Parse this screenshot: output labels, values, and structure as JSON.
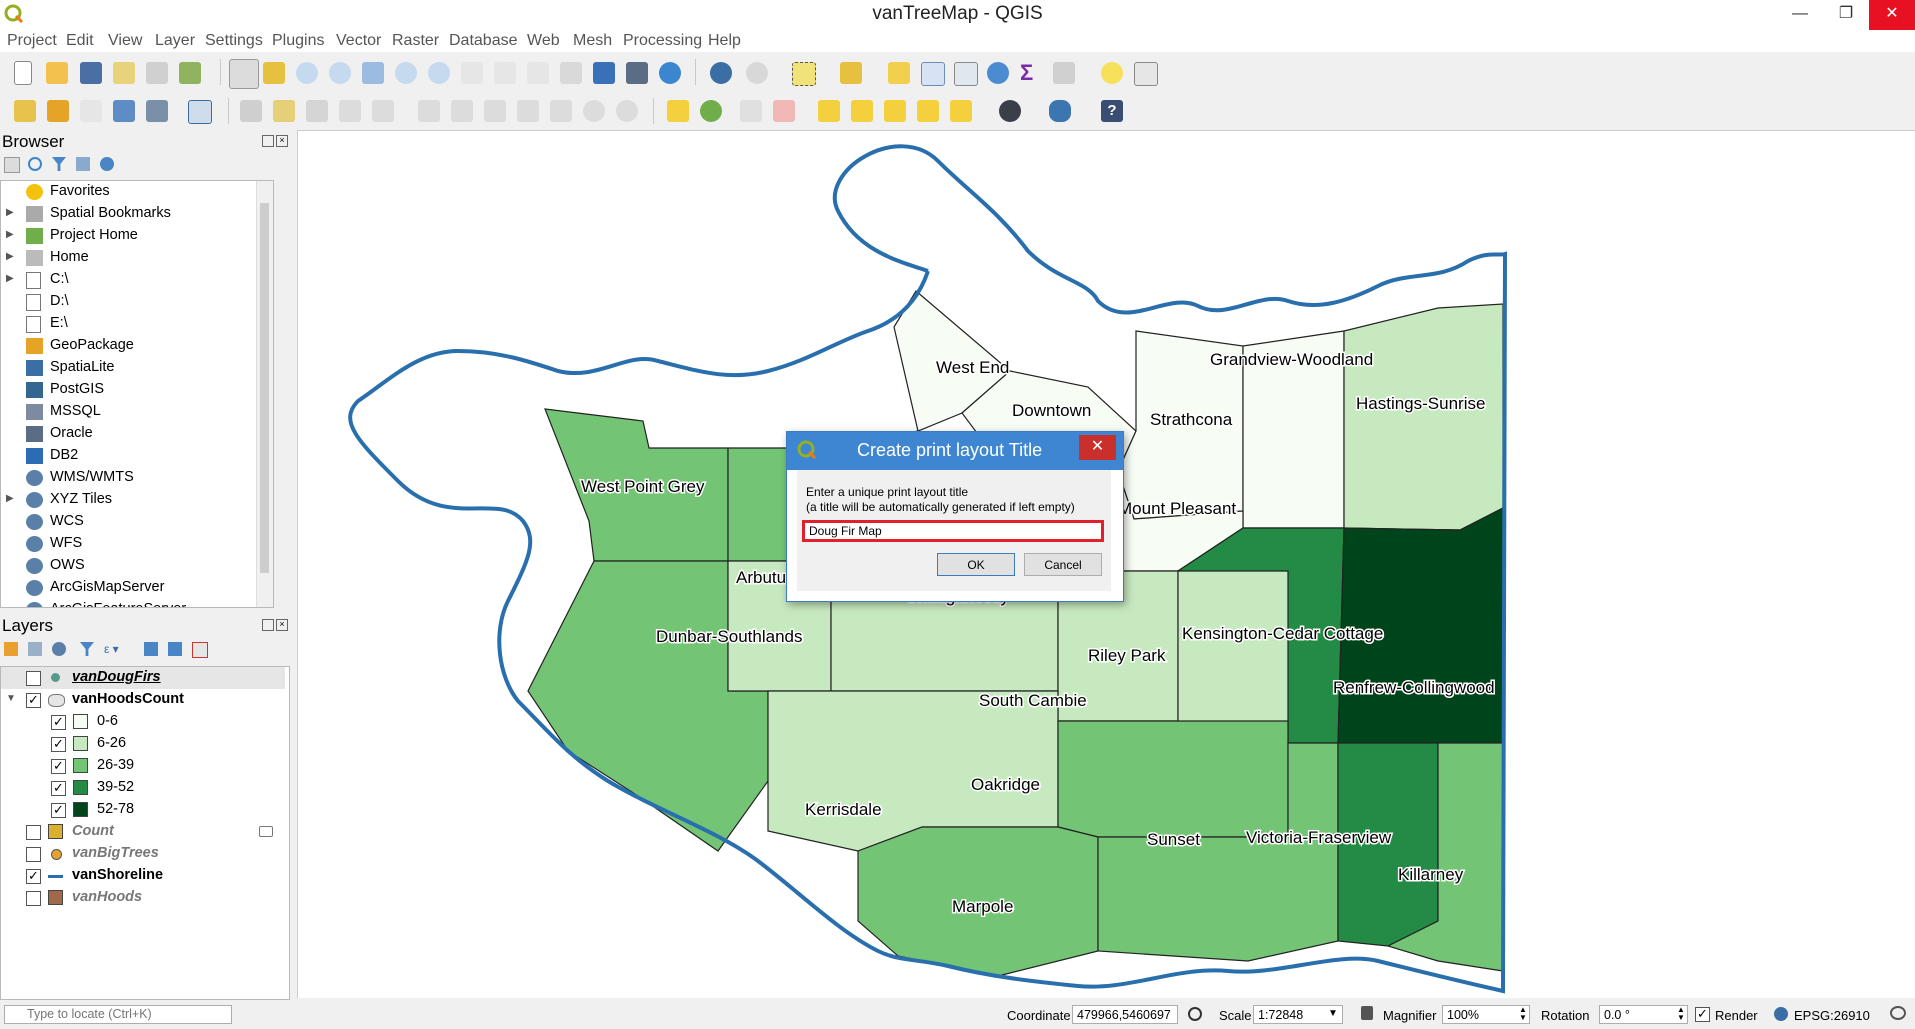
{
  "window": {
    "title": "vanTreeMap - QGIS",
    "min_glyph": "—",
    "max_glyph": "❐",
    "close_glyph": "✕"
  },
  "menu": [
    "Project",
    "Edit",
    "View",
    "Layer",
    "Settings",
    "Plugins",
    "Vector",
    "Raster",
    "Database",
    "Web",
    "Mesh",
    "Processing",
    "Help"
  ],
  "browser": {
    "title": "Browser",
    "items": [
      {
        "label": "Favorites",
        "icon": "star-icon",
        "expand": false
      },
      {
        "label": "Spatial Bookmarks",
        "icon": "bookmark-icon",
        "expand": true
      },
      {
        "label": "Project Home",
        "icon": "project-home-icon",
        "expand": true
      },
      {
        "label": "Home",
        "icon": "home-folder-icon",
        "expand": true
      },
      {
        "label": "C:\\",
        "icon": "drive-icon",
        "expand": true
      },
      {
        "label": "D:\\",
        "icon": "drive-icon",
        "expand": false
      },
      {
        "label": "E:\\",
        "icon": "drive-icon",
        "expand": false
      },
      {
        "label": "GeoPackage",
        "icon": "geopackage-icon",
        "expand": false
      },
      {
        "label": "SpatiaLite",
        "icon": "spatialite-icon",
        "expand": false
      },
      {
        "label": "PostGIS",
        "icon": "postgis-icon",
        "expand": false
      },
      {
        "label": "MSSQL",
        "icon": "mssql-icon",
        "expand": false
      },
      {
        "label": "Oracle",
        "icon": "oracle-icon",
        "expand": false
      },
      {
        "label": "DB2",
        "icon": "db2-icon",
        "expand": false
      },
      {
        "label": "WMS/WMTS",
        "icon": "globe-icon",
        "expand": false
      },
      {
        "label": "XYZ Tiles",
        "icon": "globe-icon",
        "expand": true
      },
      {
        "label": "WCS",
        "icon": "globe-icon",
        "expand": false
      },
      {
        "label": "WFS",
        "icon": "globe-icon",
        "expand": false
      },
      {
        "label": "OWS",
        "icon": "globe-icon",
        "expand": false
      },
      {
        "label": "ArcGisMapServer",
        "icon": "globe-icon",
        "expand": false
      },
      {
        "label": "ArcGisFeatureServer",
        "icon": "globe-icon",
        "expand": false
      }
    ]
  },
  "layers": {
    "title": "Layers",
    "items": [
      {
        "label": "vanDougFirs",
        "checked": false,
        "style": "italic-bold-underline",
        "icon": "point-icon",
        "indent": 0
      },
      {
        "label": "vanHoodsCount",
        "checked": true,
        "style": "bold",
        "icon": "polygon-icon",
        "indent": 0,
        "expanded": true
      },
      {
        "label": "0-6",
        "checked": true,
        "style": "normal",
        "swatch": "#f7fcf5",
        "indent": 1
      },
      {
        "label": "6-26",
        "checked": true,
        "style": "normal",
        "swatch": "#c7e9c0",
        "indent": 1
      },
      {
        "label": "26-39",
        "checked": true,
        "style": "normal",
        "swatch": "#74c476",
        "indent": 1
      },
      {
        "label": "39-52",
        "checked": true,
        "style": "normal",
        "swatch": "#238b45",
        "indent": 1
      },
      {
        "label": "52-78",
        "checked": true,
        "style": "normal",
        "swatch": "#00441b",
        "indent": 1
      },
      {
        "label": "Count",
        "checked": false,
        "style": "italic-bold-grey",
        "swatch": "#d9b030",
        "indent": 0
      },
      {
        "label": "vanBigTrees",
        "checked": false,
        "style": "italic-bold-grey",
        "icon": "orange-point-icon",
        "indent": 0
      },
      {
        "label": "vanShoreline",
        "checked": true,
        "style": "bold",
        "icon": "line-icon",
        "indent": 0
      },
      {
        "label": "vanHoods",
        "checked": false,
        "style": "italic-bold-grey",
        "swatch": "#a06a4a",
        "indent": 0
      }
    ]
  },
  "map_labels": [
    "West End",
    "Downtown",
    "Strathcona",
    "Grandview-Woodland",
    "Hastings-Sunrise",
    "West Point Grey",
    "Mount Pleasant",
    "Kensington-Cedar Cottage",
    "Renfrew-Collingwood",
    "Dunbar-Southlands",
    "Arbutus Ridge",
    "Shaughnessy",
    "Riley Park",
    "South Cambie",
    "Kerrisdale",
    "Oakridge",
    "Sunset",
    "Victoria-Fraserview",
    "Killarney",
    "Marpole"
  ],
  "dialog": {
    "title": "Create print layout Title",
    "message_line1": "Enter a unique print layout title",
    "message_line2": "(a title will be automatically generated if left empty)",
    "input_value": "Doug Fir Map",
    "ok_label": "OK",
    "cancel_label": "Cancel",
    "close_glyph": "✕"
  },
  "status": {
    "locate_placeholder": "Type to locate (Ctrl+K)",
    "coordinate_label": "Coordinate",
    "coordinate_value": "479966,5460697",
    "scale_label": "Scale",
    "scale_value": "1:72848",
    "magnifier_label": "Magnifier",
    "magnifier_value": "100%",
    "rotation_label": "Rotation",
    "rotation_value": "0.0 °",
    "render_label": "Render",
    "crs_label": "EPSG:26910"
  },
  "colors": {
    "class_0_6": "#f7fcf5",
    "class_6_26": "#c7e9c0",
    "class_26_39": "#74c476",
    "class_39_52": "#238b45",
    "class_52_78": "#00441b",
    "shoreline": "#2a6fad",
    "dialog_header": "#3f86d2",
    "highlight": "#e0202a"
  }
}
